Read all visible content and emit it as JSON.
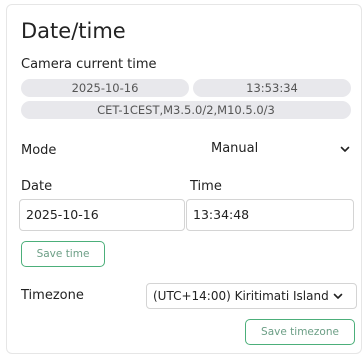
{
  "panel": {
    "title": "Date/time"
  },
  "camera": {
    "label": "Camera current time",
    "date": "2025-10-16",
    "time": "13:53:34",
    "tz": "CET-1CEST,M3.5.0/2,M10.5.0/3"
  },
  "mode": {
    "label": "Mode",
    "value": "Manual"
  },
  "date_field": {
    "label": "Date",
    "value": "2025-10-16"
  },
  "time_field": {
    "label": "Time",
    "value": "13:34:48"
  },
  "buttons": {
    "save_time": "Save time",
    "save_timezone": "Save timezone"
  },
  "timezone": {
    "label": "Timezone",
    "value": "(UTC+14:00) Kiritimati Island"
  },
  "colors": {
    "accent": "#4caf7a",
    "pill_bg": "#e8e8ec"
  },
  "icons": {
    "select_arrow": "chevron-down-icon"
  }
}
